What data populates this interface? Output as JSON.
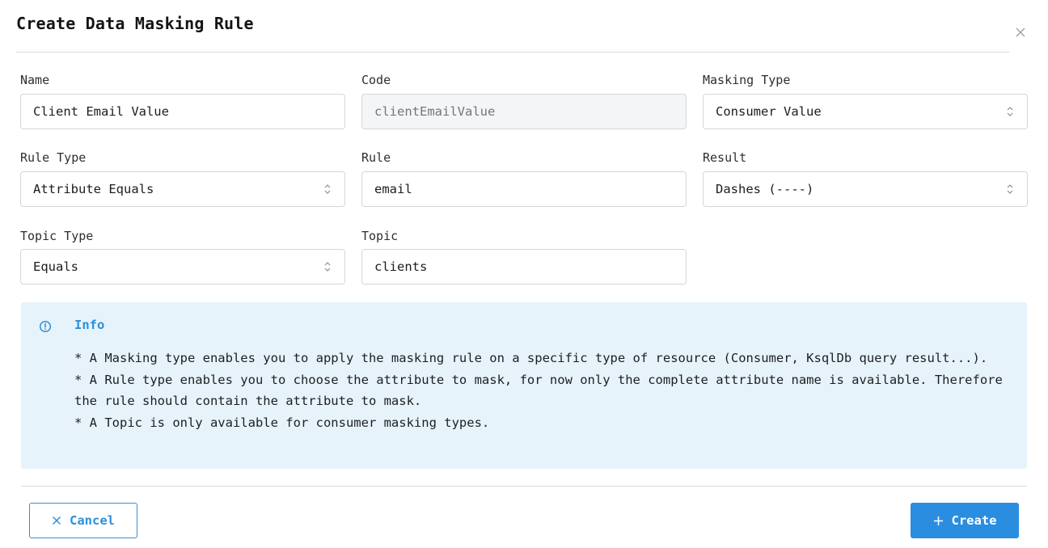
{
  "dialog": {
    "title": "Create Data Masking Rule"
  },
  "form": {
    "name": {
      "label": "Name",
      "value": "Client Email Value"
    },
    "code": {
      "label": "Code",
      "placeholder": "clientEmailValue"
    },
    "masking_type": {
      "label": "Masking Type",
      "value": "Consumer Value"
    },
    "rule_type": {
      "label": "Rule Type",
      "value": "Attribute Equals"
    },
    "rule": {
      "label": "Rule",
      "value": "email"
    },
    "result": {
      "label": "Result",
      "value": "Dashes (----)"
    },
    "topic_type": {
      "label": "Topic Type",
      "value": "Equals"
    },
    "topic": {
      "label": "Topic",
      "value": "clients"
    }
  },
  "info": {
    "title": "Info",
    "lines": [
      "* A Masking type enables you to apply the masking rule on a specific type of resource (Consumer, KsqlDb query result...).",
      "* A Rule type enables you to choose the attribute to mask, for now only the complete attribute name is available. Therefore the rule should contain the attribute to mask.",
      "* A Topic is only available for consumer masking types."
    ]
  },
  "footer": {
    "cancel_label": "Cancel",
    "create_label": "Create"
  },
  "colors": {
    "accent": "#2b8de0",
    "info_bg": "#e6f3fb"
  }
}
